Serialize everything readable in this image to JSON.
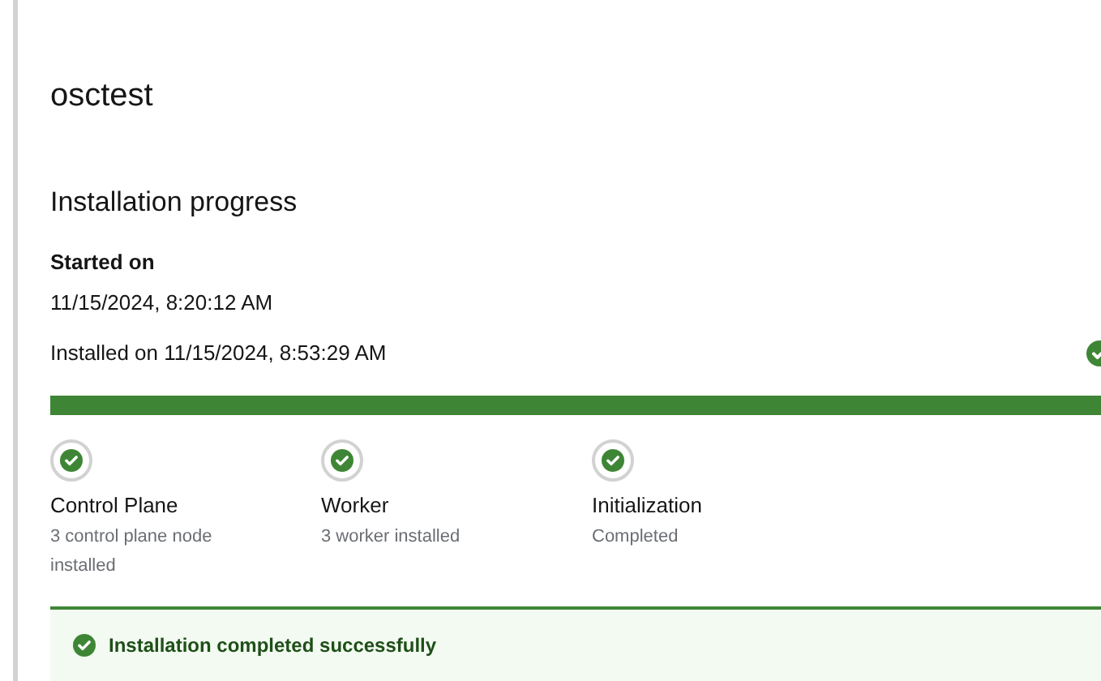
{
  "title": "osctest",
  "section_title": "Installation progress",
  "started": {
    "label": "Started on",
    "value": "11/15/2024, 8:20:12 AM"
  },
  "installed": {
    "text": "Installed on 11/15/2024, 8:53:29 AM",
    "completed": true
  },
  "progress": {
    "level": 1
  },
  "steps": [
    {
      "name": "Control Plane",
      "detail": "3 control plane node installed",
      "completed": true
    },
    {
      "name": "Worker",
      "detail": "3 worker installed",
      "completed": true
    },
    {
      "name": "Initialization",
      "detail": "Completed",
      "completed": true
    }
  ],
  "alert": {
    "kind": "success",
    "message": "Installation completed successfully"
  }
}
